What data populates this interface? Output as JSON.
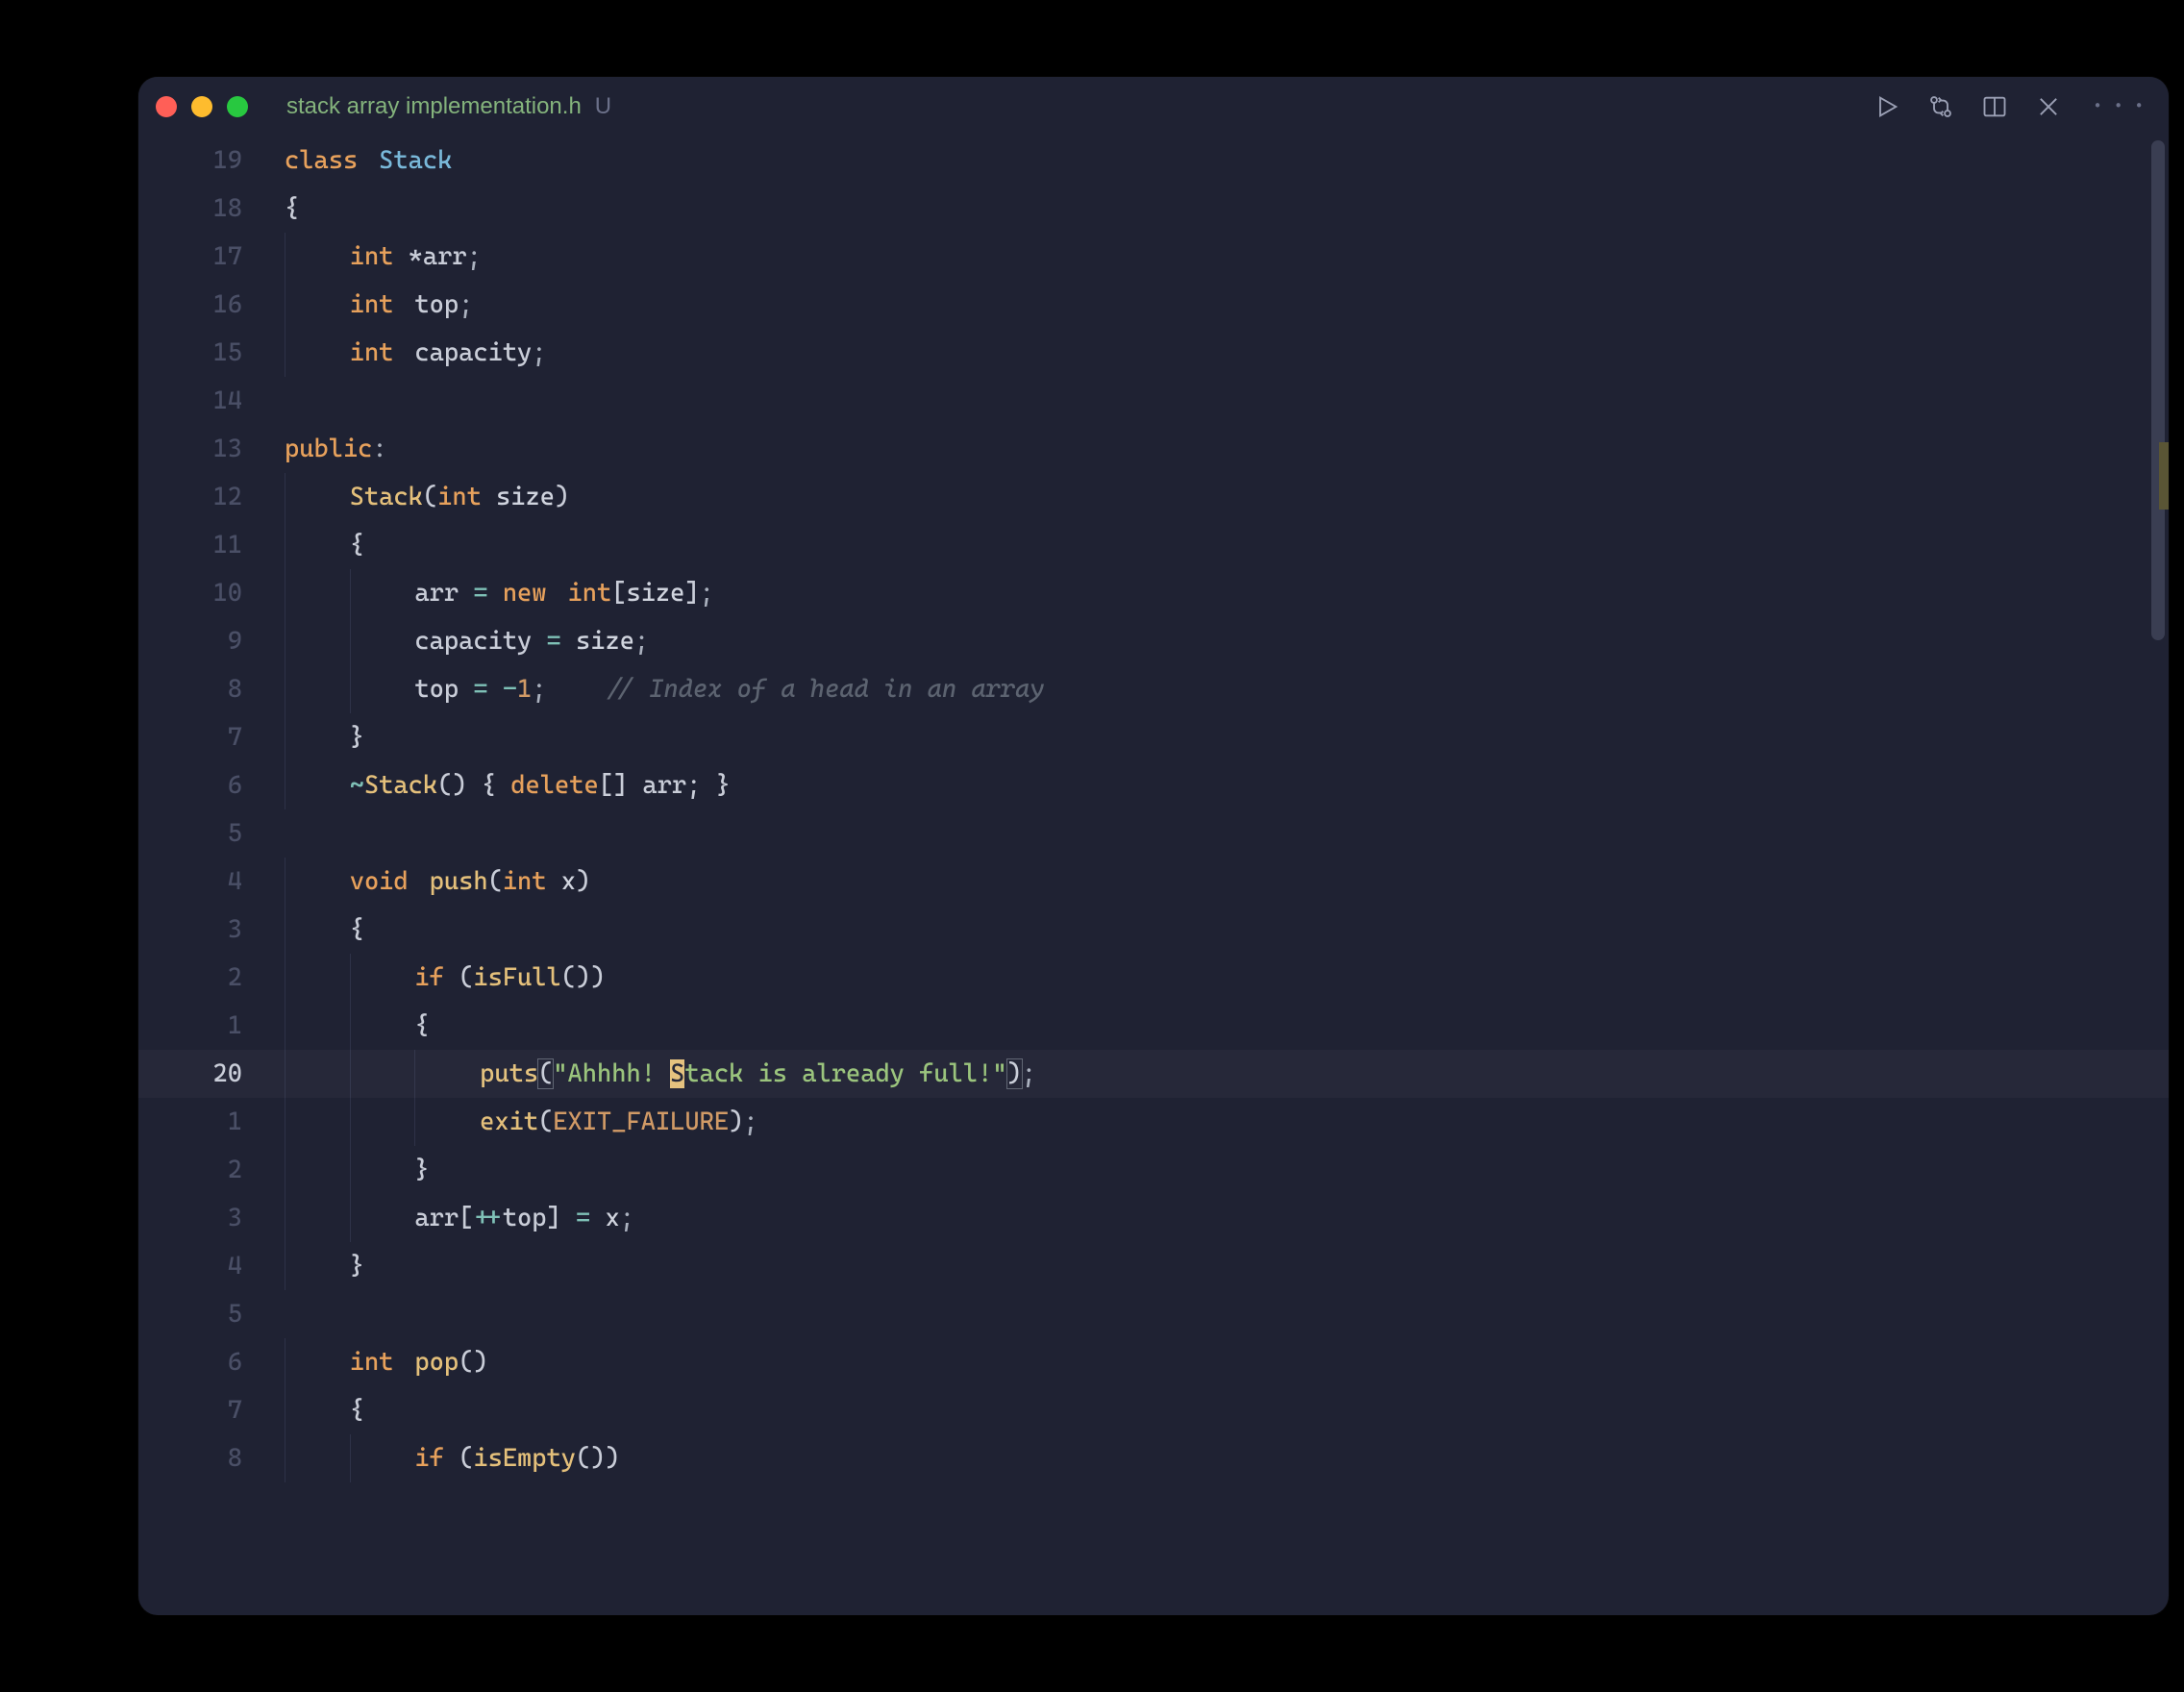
{
  "tab": {
    "filename": "stack array implementation.h",
    "unsaved_marker": "U"
  },
  "toolbar_icons": [
    "play-icon",
    "git-compare-icon",
    "split-editor-icon",
    "close-icon",
    "more-icon"
  ],
  "line_numbers": [
    "19",
    "18",
    "17",
    "16",
    "15",
    "14",
    "13",
    "12",
    "11",
    "10",
    "9",
    "8",
    "7",
    "6",
    "5",
    "4",
    "3",
    "2",
    "1",
    "20",
    "1",
    "2",
    "3",
    "4",
    "5",
    "6",
    "7",
    "8"
  ],
  "active_line_index": 19,
  "code_lines": [
    {
      "tokens": [
        {
          "t": "class",
          "c": "tk-keyword"
        },
        {
          "t": " ",
          "c": "sp"
        },
        {
          "t": "Stack",
          "c": "tk-class"
        }
      ],
      "indent": 0
    },
    {
      "tokens": [
        {
          "t": "{",
          "c": "tk-plain"
        }
      ],
      "indent": 0
    },
    {
      "tokens": [
        {
          "t": "int",
          "c": "tk-keyword"
        },
        {
          "t": " *",
          "c": "tk-plain"
        },
        {
          "t": "arr",
          "c": "tk-plain"
        },
        {
          "t": ";",
          "c": "tk-punc"
        }
      ],
      "indent": 1
    },
    {
      "tokens": [
        {
          "t": "int",
          "c": "tk-keyword"
        },
        {
          "t": " ",
          "c": "sp"
        },
        {
          "t": "top",
          "c": "tk-plain"
        },
        {
          "t": ";",
          "c": "tk-punc"
        }
      ],
      "indent": 1
    },
    {
      "tokens": [
        {
          "t": "int",
          "c": "tk-keyword"
        },
        {
          "t": " ",
          "c": "sp"
        },
        {
          "t": "capacity",
          "c": "tk-plain"
        },
        {
          "t": ";",
          "c": "tk-punc"
        }
      ],
      "indent": 1
    },
    {
      "tokens": [],
      "indent": 0
    },
    {
      "tokens": [
        {
          "t": "public",
          "c": "tk-keyword"
        },
        {
          "t": ":",
          "c": "tk-punc"
        }
      ],
      "indent": 0
    },
    {
      "tokens": [
        {
          "t": "Stack",
          "c": "tk-func"
        },
        {
          "t": "(",
          "c": "tk-bracket"
        },
        {
          "t": "int",
          "c": "tk-keyword"
        },
        {
          "t": " size",
          "c": "tk-param"
        },
        {
          "t": ")",
          "c": "tk-bracket"
        }
      ],
      "indent": 1
    },
    {
      "tokens": [
        {
          "t": "{",
          "c": "tk-plain"
        }
      ],
      "indent": 1
    },
    {
      "tokens": [
        {
          "t": "arr",
          "c": "tk-plain"
        },
        {
          "t": " = ",
          "c": "tk-op"
        },
        {
          "t": "new",
          "c": "tk-keyword"
        },
        {
          "t": " ",
          "c": "sp"
        },
        {
          "t": "int",
          "c": "tk-keyword"
        },
        {
          "t": "[",
          "c": "tk-bracket"
        },
        {
          "t": "size",
          "c": "tk-param"
        },
        {
          "t": "]",
          "c": "tk-bracket"
        },
        {
          "t": ";",
          "c": "tk-punc"
        }
      ],
      "indent": 2
    },
    {
      "tokens": [
        {
          "t": "capacity",
          "c": "tk-plain"
        },
        {
          "t": " = ",
          "c": "tk-op"
        },
        {
          "t": "size",
          "c": "tk-param"
        },
        {
          "t": ";",
          "c": "tk-punc"
        }
      ],
      "indent": 2
    },
    {
      "tokens": [
        {
          "t": "top",
          "c": "tk-plain"
        },
        {
          "t": " = ",
          "c": "tk-op"
        },
        {
          "t": "-",
          "c": "tk-op"
        },
        {
          "t": "1",
          "c": "tk-num"
        },
        {
          "t": ";",
          "c": "tk-punc"
        },
        {
          "t": "    ",
          "c": "tk-plain"
        },
        {
          "t": "// Index of a head in an array",
          "c": "tk-comment"
        }
      ],
      "indent": 2
    },
    {
      "tokens": [
        {
          "t": "}",
          "c": "tk-plain"
        }
      ],
      "indent": 1
    },
    {
      "tokens": [
        {
          "t": "~",
          "c": "tk-op"
        },
        {
          "t": "Stack",
          "c": "tk-func"
        },
        {
          "t": "() { ",
          "c": "tk-plain"
        },
        {
          "t": "delete",
          "c": "tk-keyword"
        },
        {
          "t": "[] arr; }",
          "c": "tk-plain"
        }
      ],
      "indent": 1
    },
    {
      "tokens": [],
      "indent": 0
    },
    {
      "tokens": [
        {
          "t": "void",
          "c": "tk-keyword"
        },
        {
          "t": " ",
          "c": "sp"
        },
        {
          "t": "push",
          "c": "tk-func"
        },
        {
          "t": "(",
          "c": "tk-bracket"
        },
        {
          "t": "int",
          "c": "tk-keyword"
        },
        {
          "t": " x",
          "c": "tk-param"
        },
        {
          "t": ")",
          "c": "tk-bracket"
        }
      ],
      "indent": 1
    },
    {
      "tokens": [
        {
          "t": "{",
          "c": "tk-plain"
        }
      ],
      "indent": 1
    },
    {
      "tokens": [
        {
          "t": "if",
          "c": "tk-keyword"
        },
        {
          "t": " (",
          "c": "tk-plain"
        },
        {
          "t": "isFull",
          "c": "tk-func"
        },
        {
          "t": "())",
          "c": "tk-plain"
        }
      ],
      "indent": 2
    },
    {
      "tokens": [
        {
          "t": "{",
          "c": "tk-plain"
        }
      ],
      "indent": 2
    },
    {
      "tokens": [
        {
          "t": "puts",
          "c": "tk-func"
        },
        {
          "t": "(",
          "c": "tk-bracket bracket-match"
        },
        {
          "t": "\"Ahhhh! ",
          "c": "tk-string"
        },
        {
          "t": "S",
          "c": "tk-string match-hl"
        },
        {
          "t": "tack is already full!\"",
          "c": "tk-string"
        },
        {
          "t": ")",
          "c": "tk-bracket bracket-match"
        },
        {
          "t": ";",
          "c": "tk-punc"
        }
      ],
      "indent": 3,
      "active": true
    },
    {
      "tokens": [
        {
          "t": "exit",
          "c": "tk-func"
        },
        {
          "t": "(",
          "c": "tk-bracket"
        },
        {
          "t": "EXIT_FAILURE",
          "c": "tk-const"
        },
        {
          "t": ")",
          "c": "tk-bracket"
        },
        {
          "t": ";",
          "c": "tk-punc"
        }
      ],
      "indent": 3
    },
    {
      "tokens": [
        {
          "t": "}",
          "c": "tk-plain"
        }
      ],
      "indent": 2
    },
    {
      "tokens": [
        {
          "t": "arr",
          "c": "tk-plain"
        },
        {
          "t": "[",
          "c": "tk-bracket"
        },
        {
          "t": "++",
          "c": "tk-op"
        },
        {
          "t": "top",
          "c": "tk-plain"
        },
        {
          "t": "]",
          "c": "tk-bracket"
        },
        {
          "t": " = ",
          "c": "tk-op"
        },
        {
          "t": "x",
          "c": "tk-param"
        },
        {
          "t": ";",
          "c": "tk-punc"
        }
      ],
      "indent": 2
    },
    {
      "tokens": [
        {
          "t": "}",
          "c": "tk-plain"
        }
      ],
      "indent": 1
    },
    {
      "tokens": [],
      "indent": 0
    },
    {
      "tokens": [
        {
          "t": "int",
          "c": "tk-keyword"
        },
        {
          "t": " ",
          "c": "sp"
        },
        {
          "t": "pop",
          "c": "tk-func"
        },
        {
          "t": "()",
          "c": "tk-plain"
        }
      ],
      "indent": 1
    },
    {
      "tokens": [
        {
          "t": "{",
          "c": "tk-plain"
        }
      ],
      "indent": 1
    },
    {
      "tokens": [
        {
          "t": "if",
          "c": "tk-keyword"
        },
        {
          "t": " (",
          "c": "tk-plain"
        },
        {
          "t": "isEmpty",
          "c": "tk-func"
        },
        {
          "t": "())",
          "c": "tk-plain"
        }
      ],
      "indent": 2
    }
  ]
}
